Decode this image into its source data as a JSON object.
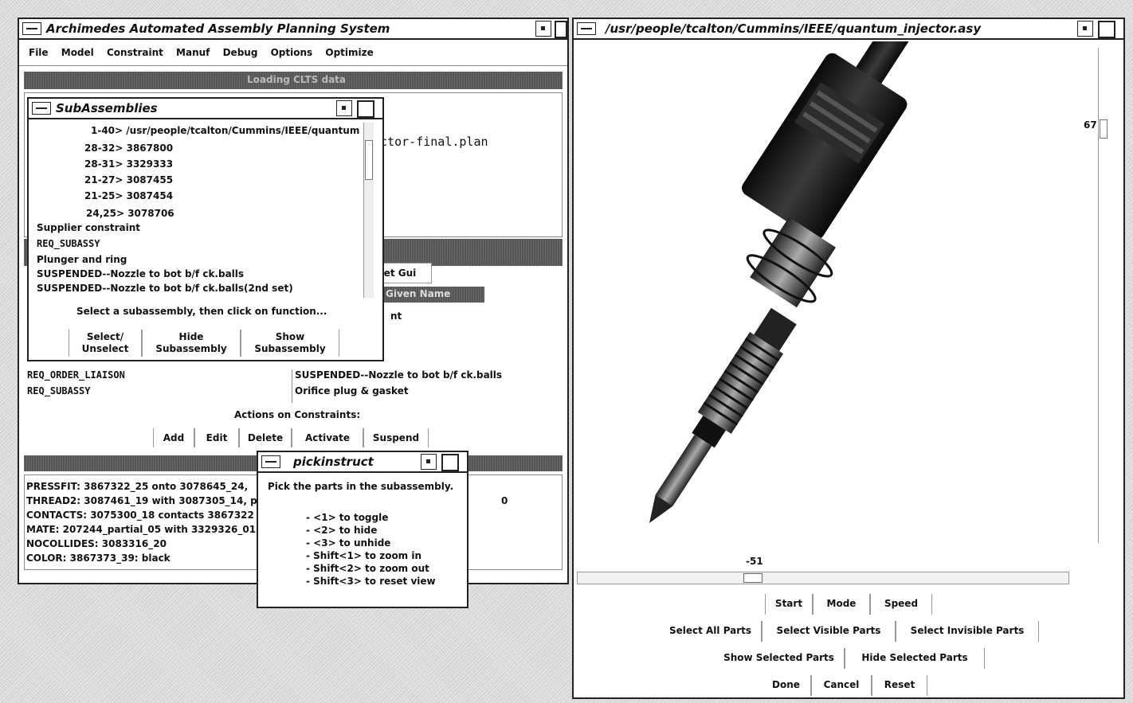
{
  "main": {
    "title": "Archimedes Automated Assembly Planning System",
    "menu": [
      "File",
      "Model",
      "Constraint",
      "Manuf",
      "Debug",
      "Options",
      "Optimize"
    ],
    "status_bar": "Loading CLTS data",
    "plan_file": "jector-final.plan",
    "reset_gui": "et Gui",
    "given_name": "Given Name",
    "nt_label": "nt",
    "constraints": [
      {
        "type": "REQ_ORDER_LIAISON",
        "desc": "SUSPENDED--Nozzle to bot b/f ck.balls"
      },
      {
        "type": "REQ_SUBASSY",
        "desc": "Orifice plug & gasket"
      }
    ],
    "actions_label": "Actions on Constraints:",
    "actions": [
      "Add",
      "Edit",
      "Delete",
      "Activate",
      "Suspend"
    ],
    "log_lines": [
      "PRESSFIT: 3867322_25 onto 3078645_24,",
      "THREAD2: 3087461_19 with 3087305_14, p",
      "CONTACTS: 3075300_18 contacts 3867322",
      "MATE: 207244_partial_05 with 3329326_01",
      "NOCOLLIDES: 3083316_20",
      "COLOR: 3867373_39: black"
    ],
    "log_tail": "0"
  },
  "subassemblies": {
    "title": "SubAssemblies",
    "items": [
      "1-40> /usr/people/tcalton/Cummins/IEEE/quantum",
      "28-32> 3867800",
      "28-31> 3329333",
      "21-27> 3087455",
      "21-25> 3087454",
      "24,25> 3078706",
      "Supplier constraint",
      "REQ_SUBASSY",
      "Plunger and ring",
      "SUSPENDED--Nozzle to bot b/f ck.balls",
      "SUSPENDED--Nozzle to bot b/f ck.balls(2nd set)"
    ],
    "hint": "Select a subassembly, then click on function...",
    "buttons": [
      {
        "line1": "Select/",
        "line2": "Unselect"
      },
      {
        "line1": "Hide",
        "line2": "Subassembly"
      },
      {
        "line1": "Show",
        "line2": "Subassembly"
      }
    ]
  },
  "pick": {
    "title": "pickinstruct",
    "heading": "Pick the parts in the subassembly.",
    "lines": [
      "- <1> to toggle",
      "- <2> to hide",
      "- <3> to unhide",
      "- Shift<1> to zoom in",
      "- Shift<2> to zoom out",
      "- Shift<3> to reset view"
    ]
  },
  "viewer": {
    "title": "/usr/people/tcalton/Cummins/IEEE/quantum_injector.asy",
    "vertical_value": "67",
    "horizontal_value": "-51",
    "row1": [
      "Start",
      "Mode",
      "Speed"
    ],
    "row2": [
      "Select All Parts",
      "Select Visible Parts",
      "Select Invisible Parts"
    ],
    "row3": [
      "Show Selected Parts",
      "Hide Selected Parts"
    ],
    "row4": [
      "Done",
      "Cancel",
      "Reset"
    ]
  }
}
